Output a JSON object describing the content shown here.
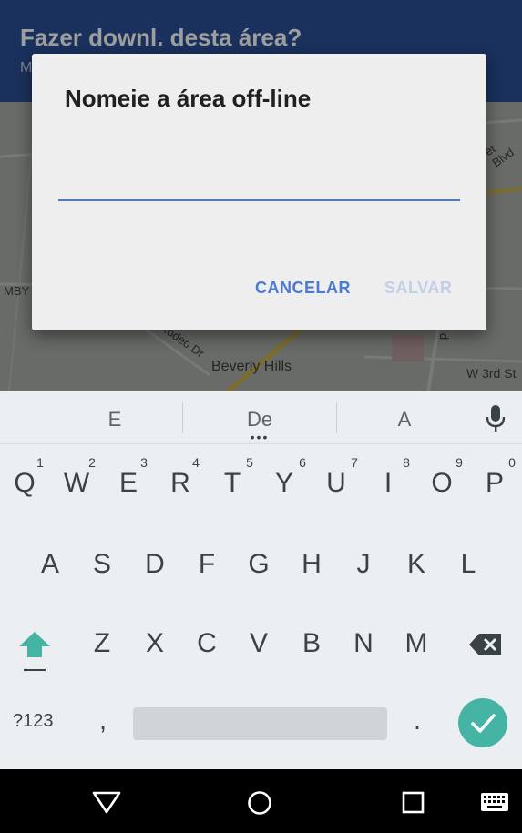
{
  "appbar": {
    "title": "Fazer downl. desta área?",
    "subtitle": "M"
  },
  "map": {
    "labels": [
      "Beverly Hills",
      "W 3rd St",
      "MBY",
      "Rodeo Dr",
      "et Blvd",
      "d"
    ]
  },
  "dialog": {
    "title": "Nomeie a área off-line",
    "input_value": "",
    "cancel_label": "CANCELAR",
    "save_label": "SALVAR"
  },
  "keyboard": {
    "suggestions": [
      "E",
      "De",
      "A"
    ],
    "row1": [
      "Q",
      "W",
      "E",
      "R",
      "T",
      "Y",
      "U",
      "I",
      "O",
      "P"
    ],
    "row1_hints": [
      "1",
      "2",
      "3",
      "4",
      "5",
      "6",
      "7",
      "8",
      "9",
      "0"
    ],
    "row2": [
      "A",
      "S",
      "D",
      "F",
      "G",
      "H",
      "J",
      "K",
      "L"
    ],
    "row3": [
      "Z",
      "X",
      "C",
      "V",
      "B",
      "N",
      "M"
    ],
    "symbols_label": "?123",
    "comma": ",",
    "period": ".",
    "icons": [
      "microphone-icon",
      "shift-icon",
      "backspace-icon",
      "checkmark-icon"
    ]
  },
  "navbar": {
    "icons": [
      "back-icon",
      "home-icon",
      "recents-icon",
      "keyboard-icon"
    ]
  },
  "colors": {
    "appbar": "#2b4f96",
    "accent": "#4a7ad3",
    "enter": "#45b4a4"
  }
}
